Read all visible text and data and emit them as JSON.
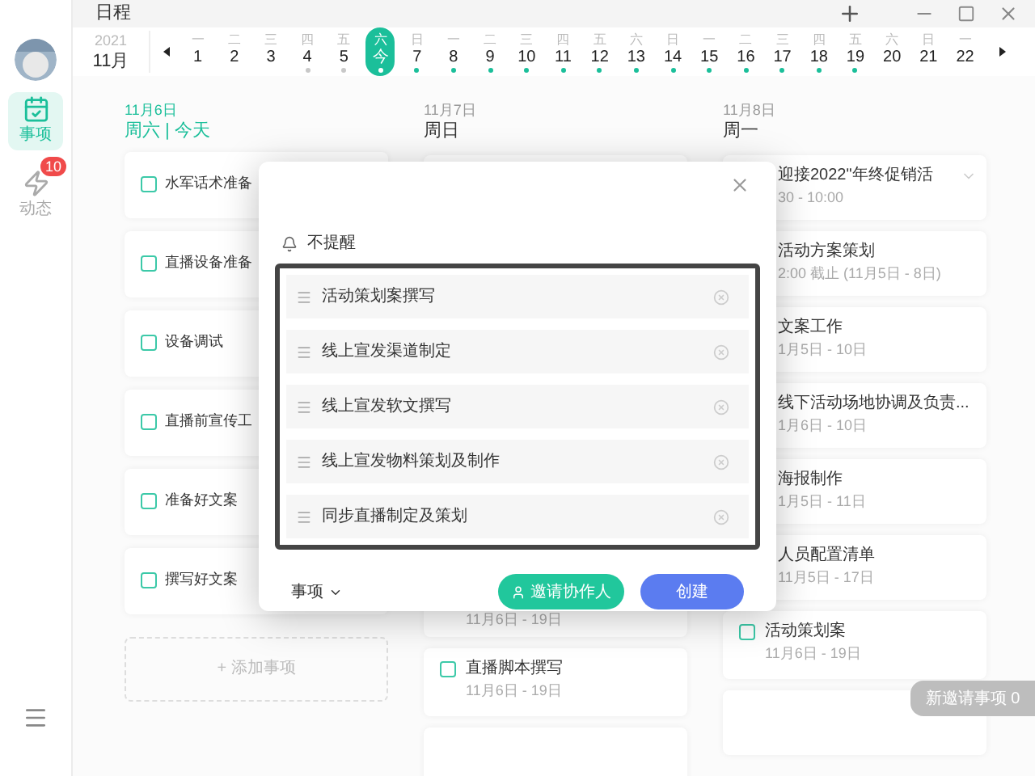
{
  "window": {
    "title": "日程"
  },
  "sidebar": {
    "items": [
      {
        "label": "事项",
        "selected": true
      },
      {
        "label": "动态",
        "selected": false,
        "badge": "10"
      }
    ]
  },
  "date_strip": {
    "year": "2021",
    "month": "11月",
    "days": [
      {
        "weekday": "一",
        "day": "1",
        "selected": false
      },
      {
        "weekday": "二",
        "day": "2",
        "selected": false
      },
      {
        "weekday": "三",
        "day": "3",
        "selected": false
      },
      {
        "weekday": "四",
        "day": "4",
        "selected": false,
        "color": "#c8c8c8"
      },
      {
        "weekday": "五",
        "day": "5",
        "selected": false,
        "color": "#c8c8c8"
      },
      {
        "weekday": "六",
        "day": "今",
        "selected": true,
        "color": "#ffffff"
      },
      {
        "weekday": "日",
        "day": "7",
        "selected": false,
        "color": "#1bbf9a"
      },
      {
        "weekday": "一",
        "day": "8",
        "selected": false,
        "color": "#1bbf9a"
      },
      {
        "weekday": "二",
        "day": "9",
        "selected": false,
        "color": "#1bbf9a"
      },
      {
        "weekday": "三",
        "day": "10",
        "selected": false,
        "color": "#1bbf9a"
      },
      {
        "weekday": "四",
        "day": "11",
        "selected": false,
        "color": "#1bbf9a"
      },
      {
        "weekday": "五",
        "day": "12",
        "selected": false,
        "color": "#1bbf9a"
      },
      {
        "weekday": "六",
        "day": "13",
        "selected": false,
        "color": "#1bbf9a"
      },
      {
        "weekday": "日",
        "day": "14",
        "selected": false,
        "color": "#1bbf9a"
      },
      {
        "weekday": "一",
        "day": "15",
        "selected": false,
        "color": "#1bbf9a"
      },
      {
        "weekday": "二",
        "day": "16",
        "selected": false,
        "color": "#1bbf9a"
      },
      {
        "weekday": "三",
        "day": "17",
        "selected": false,
        "color": "#1bbf9a"
      },
      {
        "weekday": "四",
        "day": "18",
        "selected": false,
        "color": "#1bbf9a"
      },
      {
        "weekday": "五",
        "day": "19",
        "selected": false,
        "color": "#1bbf9a"
      },
      {
        "weekday": "六",
        "day": "20",
        "selected": false
      },
      {
        "weekday": "日",
        "day": "21",
        "selected": false
      },
      {
        "weekday": "一",
        "day": "22",
        "selected": false
      }
    ]
  },
  "columns": [
    {
      "date": "11月6日",
      "title": "周六 | 今天",
      "today": true,
      "items": [
        {
          "title": "水军话术准备",
          "checked": false
        },
        {
          "title": "直播设备准备",
          "checked": false
        },
        {
          "title": "设备调试",
          "checked": false
        },
        {
          "title": "直播前宣传工",
          "checked": false
        },
        {
          "title": "准备好文案",
          "checked": false
        },
        {
          "title": "撰写好文案",
          "checked": false
        }
      ],
      "add_label": "+ 添加事项"
    },
    {
      "date": "11月7日",
      "title": "周日",
      "today": false,
      "items": [
        {
          "kind": "covered",
          "subtitle": "11月6日 - 19日"
        },
        {
          "kind": "task",
          "title": "直播脚本撰写",
          "subtitle": "11月6日 - 19日",
          "checked": false
        },
        {
          "kind": "empty"
        }
      ]
    },
    {
      "date": "11月8日",
      "title": "周一",
      "today": false,
      "items": [
        {
          "kind": "partial",
          "title": "迎接2022\"年终促销活",
          "subtitle": "30 - 10:00",
          "expandable": true
        },
        {
          "kind": "partial",
          "title": "活动方案策划",
          "subtitle": "2:00 截止 (11月5日 - 8日)"
        },
        {
          "kind": "partial",
          "title": "文案工作",
          "subtitle": "1月5日 - 10日"
        },
        {
          "kind": "partial",
          "title": "线下活动场地协调及负责...",
          "subtitle": "1月6日 - 10日"
        },
        {
          "kind": "partial",
          "title": "海报制作",
          "subtitle": "1月5日 - 11日"
        },
        {
          "kind": "partial",
          "title": "人员配置清单",
          "subtitle": "11月5日 - 17日"
        },
        {
          "kind": "task",
          "title": "活动策划案",
          "subtitle": "11月6日 - 19日",
          "checked": false
        },
        {
          "kind": "empty"
        }
      ]
    }
  ],
  "dialog": {
    "reminder": "不提醒",
    "subtasks": [
      "活动策划案撰写",
      "线上宣发渠道制定",
      "线上宣发软文撰写",
      "线上宣发物料策划及制作",
      "同步直播制定及策划"
    ],
    "type_label": "事项",
    "invite_button": "邀请协作人",
    "create_button": "创建"
  },
  "toast": "新邀请事项 0"
}
